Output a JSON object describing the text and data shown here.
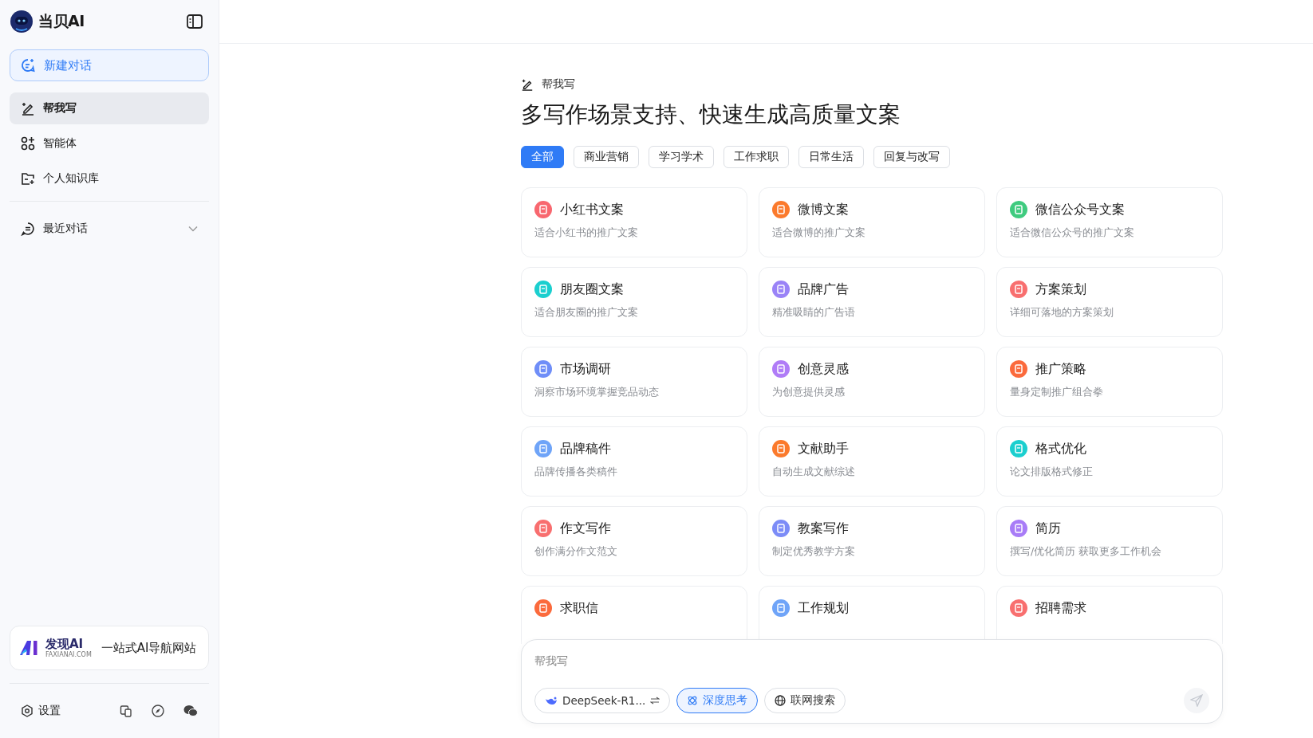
{
  "sidebar": {
    "brand": "当贝AI",
    "new_chat": "新建对话",
    "items": [
      {
        "label": "帮我写",
        "kind": "write",
        "selected": true
      },
      {
        "label": "智能体",
        "kind": "agents",
        "selected": false
      },
      {
        "label": "个人知识库",
        "kind": "folder",
        "selected": false
      }
    ],
    "recent": {
      "label": "最近对话",
      "expanded": false
    },
    "banner": {
      "brand": "发现AI",
      "domain": "FAXIANAI.COM",
      "slogan": "一站式AI导航网站"
    },
    "settings": "设置"
  },
  "main": {
    "section_label": "帮我写",
    "heading": "多写作场景支持、快速生成高质量文案",
    "tabs": [
      {
        "label": "全部",
        "selected": true
      },
      {
        "label": "商业营销",
        "selected": false
      },
      {
        "label": "学习学术",
        "selected": false
      },
      {
        "label": "工作求职",
        "selected": false
      },
      {
        "label": "日常生活",
        "selected": false
      },
      {
        "label": "回复与改写",
        "selected": false
      }
    ],
    "cards": [
      {
        "title": "小红书文案",
        "description": "适合小红书的推广文案",
        "color": "#f8676f"
      },
      {
        "title": "微博文案",
        "description": "适合微博的推广文案",
        "color": "#fb7a2c"
      },
      {
        "title": "微信公众号文案",
        "description": "适合微信公众号的推广文案",
        "color": "#3fcb7f"
      },
      {
        "title": "朋友圈文案",
        "description": "适合朋友圈的推广文案",
        "color": "#1bcfcf"
      },
      {
        "title": "品牌广告",
        "description": "精准吸睛的广告语",
        "color": "#9a83f7"
      },
      {
        "title": "方案策划",
        "description": "详细可落地的方案策划",
        "color": "#f86f6f"
      },
      {
        "title": "市场调研",
        "description": "洞察市场环境掌握竞品动态",
        "color": "#6f8ef8"
      },
      {
        "title": "创意灵感",
        "description": "为创意提供灵感",
        "color": "#b07cf7"
      },
      {
        "title": "推广策略",
        "description": "量身定制推广组合拳",
        "color": "#fb6a3c"
      },
      {
        "title": "品牌稿件",
        "description": "品牌传播各类稿件",
        "color": "#6fa4f8"
      },
      {
        "title": "文献助手",
        "description": "自动生成文献综述",
        "color": "#fb7a2c"
      },
      {
        "title": "格式优化",
        "description": "论文排版格式修正",
        "color": "#1bcfcf"
      },
      {
        "title": "作文写作",
        "description": "创作满分作文范文",
        "color": "#f86f6f"
      },
      {
        "title": "教案写作",
        "description": "制定优秀教学方案",
        "color": "#7c8cf7"
      },
      {
        "title": "简历",
        "description": "撰写/优化简历 获取更多工作机会",
        "color": "#a87cf7"
      },
      {
        "title": "求职信",
        "color": "#fb6a3c"
      },
      {
        "title": "工作规划",
        "color": "#6fa4f8"
      },
      {
        "title": "招聘需求",
        "color": "#f86f6f"
      }
    ],
    "composer": {
      "placeholder": "帮我写",
      "model": "DeepSeek-R1...",
      "toggles": [
        {
          "label": "深度思考",
          "kind": "think",
          "selected": true
        },
        {
          "label": "联网搜索",
          "kind": "web",
          "selected": false
        }
      ]
    }
  }
}
